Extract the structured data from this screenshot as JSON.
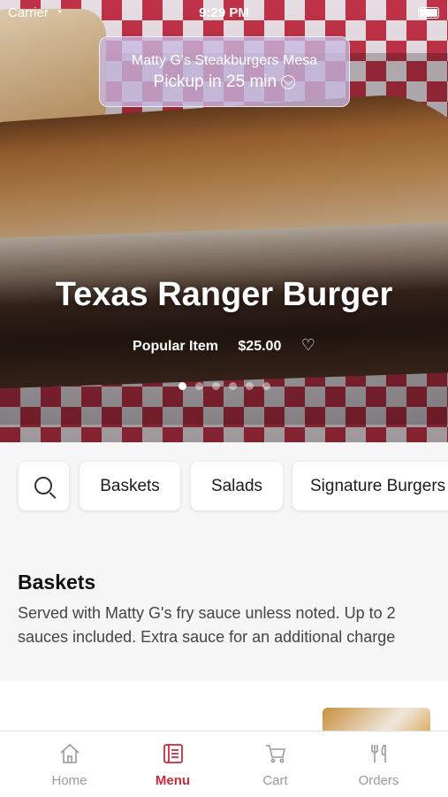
{
  "status_bar": {
    "carrier": "Carrier",
    "time": "9:29 PM"
  },
  "pickup": {
    "store": "Matty G's Steakburgers Mesa",
    "eta": "Pickup in 25 min",
    "chevron": "⌵"
  },
  "hero": {
    "title": "Texas Ranger Burger",
    "tag": "Popular Item",
    "price": "$25.00",
    "heart": "♡",
    "carousel_pages": 6,
    "carousel_active": 1
  },
  "categories": [
    "Baskets",
    "Salads",
    "Signature Burgers"
  ],
  "section": {
    "title": "Baskets",
    "description": "Served with Matty G's fry sauce unless noted. Up to 2 sauces included. Extra sauce for an additional charge"
  },
  "tabs": [
    {
      "label": "Home",
      "icon": "home-icon",
      "active": false
    },
    {
      "label": "Menu",
      "icon": "menu-icon",
      "active": true
    },
    {
      "label": "Cart",
      "icon": "cart-icon",
      "active": false
    },
    {
      "label": "Orders",
      "icon": "orders-icon",
      "active": false
    }
  ],
  "colors": {
    "accent": "#d3283c",
    "tab_inactive": "#9a9a9a"
  }
}
